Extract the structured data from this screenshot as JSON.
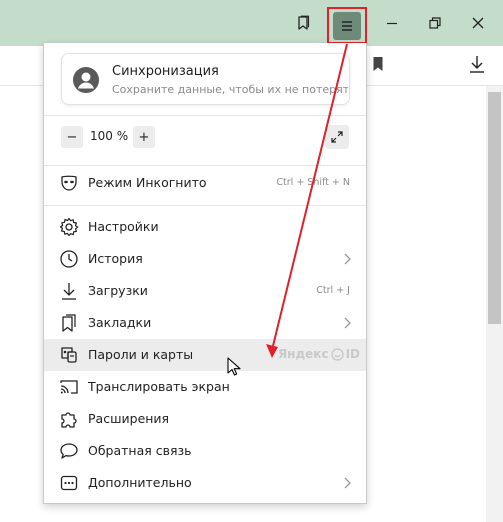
{
  "colors": {
    "titlebar_bg": "#c4dcca",
    "menu_button_bg": "#6f8a78",
    "annotation_red": "#e0202a",
    "hover_bg": "#ececec"
  },
  "titlebar": {
    "icons": [
      "bookmarks-panel-icon",
      "hamburger-menu-icon",
      "minimize-icon",
      "restore-icon",
      "close-icon"
    ]
  },
  "toolbar": {
    "icons": [
      "bookmark-icon",
      "download-icon"
    ]
  },
  "menu": {
    "sync": {
      "title": "Синхронизация",
      "subtitle": "Сохраните данные, чтобы их не потерять"
    },
    "zoom": {
      "minus": "−",
      "value": "100 %",
      "plus": "+"
    },
    "incognito": {
      "label": "Режим Инкогнито",
      "shortcut": "Ctrl + Shift + N"
    },
    "items": [
      {
        "label": "Настройки",
        "icon": "gear-icon"
      },
      {
        "label": "История",
        "icon": "history-clock-icon",
        "submenu": true
      },
      {
        "label": "Загрузки",
        "icon": "download-icon",
        "shortcut": "Ctrl + J"
      },
      {
        "label": "Закладки",
        "icon": "bookmarks-icon",
        "submenu": true
      },
      {
        "label": "Пароли и карты",
        "icon": "passwords-cards-icon",
        "badge": "Яндекс ID",
        "hovered": true
      },
      {
        "label": "Транслировать экран",
        "icon": "cast-icon"
      },
      {
        "label": "Расширения",
        "icon": "puzzle-icon"
      },
      {
        "label": "Обратная связь",
        "icon": "feedback-icon"
      },
      {
        "label": "Дополнительно",
        "icon": "more-icon",
        "submenu": true
      }
    ],
    "yandex_id": {
      "part1": "Яндекс",
      "part2": "ID"
    }
  }
}
